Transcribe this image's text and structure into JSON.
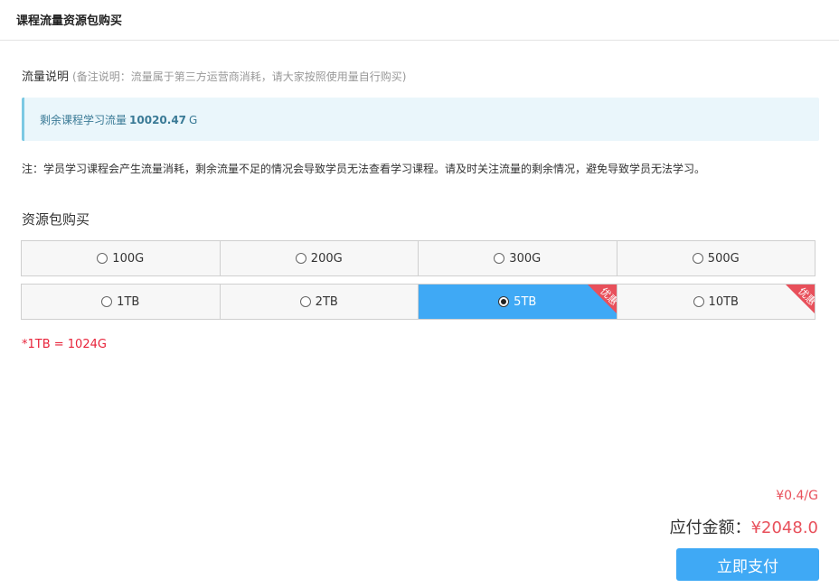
{
  "header": {
    "title": "课程流量资源包购买"
  },
  "description": {
    "label": "流量说明",
    "note": "(备注说明：流量属于第三方运营商消耗，请大家按照使用量自行购买)"
  },
  "remaining": {
    "label": "剩余课程学习流量",
    "value": "10020.47",
    "unit": "G"
  },
  "notice": "注：学员学习课程会产生流量消耗，剩余流量不足的情况会导致学员无法查看学习课程。请及时关注流量的剩余情况，避免导致学员无法学习。",
  "packages": {
    "title": "资源包购买",
    "rows": [
      [
        {
          "label": "100G",
          "selected": false,
          "badge": ""
        },
        {
          "label": "200G",
          "selected": false,
          "badge": ""
        },
        {
          "label": "300G",
          "selected": false,
          "badge": ""
        },
        {
          "label": "500G",
          "selected": false,
          "badge": ""
        }
      ],
      [
        {
          "label": "1TB",
          "selected": false,
          "badge": ""
        },
        {
          "label": "2TB",
          "selected": false,
          "badge": ""
        },
        {
          "label": "5TB",
          "selected": true,
          "badge": "优惠"
        },
        {
          "label": "10TB",
          "selected": false,
          "badge": "优惠"
        }
      ]
    ],
    "conversion_note": "*1TB = 1024G"
  },
  "pricing": {
    "unit_price": "¥0.4/G",
    "total_label": "应付金额：",
    "total_value": "¥2048.0"
  },
  "pay_button": {
    "label": "立即支付"
  },
  "colors": {
    "accent": "#3fa9f5",
    "badge": "#e8505b",
    "price": "#e8505b",
    "warning_text": "#e8233a",
    "info_background": "#eaf6fb"
  }
}
